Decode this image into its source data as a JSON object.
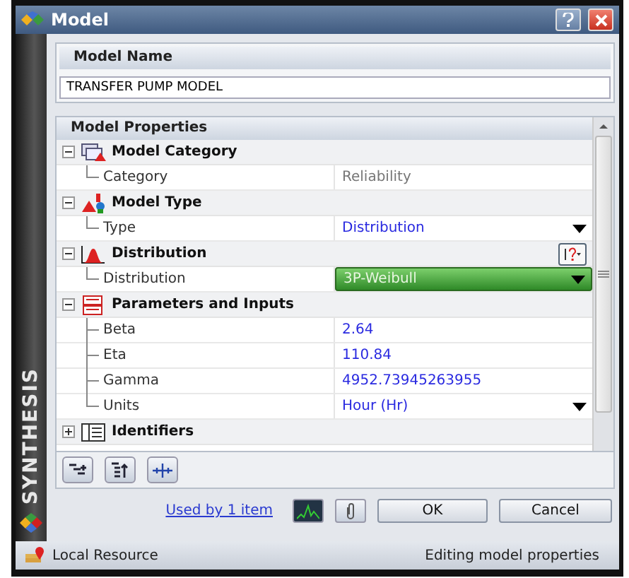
{
  "window": {
    "title": "Model"
  },
  "sidebar": {
    "brand": "SYNTHESIS"
  },
  "model_name": {
    "header": "Model Name",
    "value": "TRANSFER PUMP MODEL"
  },
  "properties": {
    "header": "Model Properties",
    "groups": [
      {
        "label": "Model Category",
        "expanded": true,
        "help": false,
        "rows": [
          {
            "name": "Category",
            "value": "Reliability",
            "kind": "readonly"
          }
        ]
      },
      {
        "label": "Model Type",
        "expanded": true,
        "help": false,
        "rows": [
          {
            "name": "Type",
            "value": "Distribution",
            "kind": "dropdown"
          }
        ]
      },
      {
        "label": "Distribution",
        "expanded": true,
        "help": true,
        "rows": [
          {
            "name": "Distribution",
            "value": "3P-Weibull",
            "kind": "combo"
          }
        ]
      },
      {
        "label": "Parameters and Inputs",
        "expanded": true,
        "help": false,
        "rows": [
          {
            "name": "Beta",
            "value": "2.64",
            "kind": "text"
          },
          {
            "name": "Eta",
            "value": "110.84",
            "kind": "text"
          },
          {
            "name": "Gamma",
            "value": "4952.73945263955",
            "kind": "text"
          },
          {
            "name": "Units",
            "value": "Hour (Hr)",
            "kind": "dropdown"
          }
        ]
      },
      {
        "label": "Identifiers",
        "expanded": false,
        "help": false
      }
    ]
  },
  "footer": {
    "link": "Used by 1 item",
    "buttons": [
      "OK",
      "Cancel"
    ]
  },
  "status_bar": {
    "location": "Local Resource",
    "message": "Editing model properties"
  }
}
